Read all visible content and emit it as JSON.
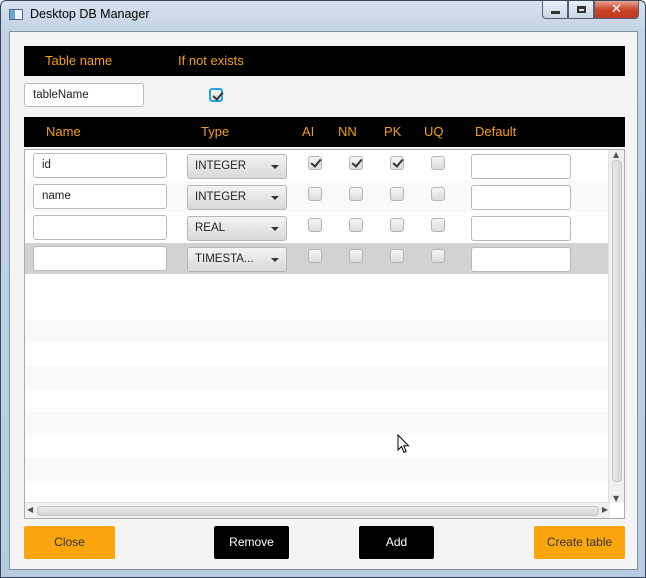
{
  "window": {
    "title": "Desktop DB Manager",
    "controls": {
      "minimize": "min",
      "maximize": "max",
      "close": "X"
    }
  },
  "table_settings": {
    "table_name_label": "Table name",
    "if_not_exists_label": "If not exists",
    "table_name_value": "tableName",
    "if_not_exists_checked": true
  },
  "columns_header": [
    "Name",
    "Type",
    "AI",
    "NN",
    "PK",
    "UQ",
    "Default"
  ],
  "rows": [
    {
      "name": "id",
      "type": "INTEGER",
      "ai": true,
      "nn": true,
      "pk": true,
      "uq": false,
      "default": ""
    },
    {
      "name": "name",
      "type": "INTEGER",
      "ai": false,
      "nn": false,
      "pk": false,
      "uq": false,
      "default": ""
    },
    {
      "name": "",
      "type": "REAL",
      "ai": false,
      "nn": false,
      "pk": false,
      "uq": false,
      "default": ""
    },
    {
      "name": "",
      "type": "TIMESTA...",
      "ai": false,
      "nn": false,
      "pk": false,
      "uq": false,
      "default": "",
      "selected": true
    }
  ],
  "buttons": {
    "close": "Close",
    "remove": "Remove",
    "add": "Add",
    "create_table": "Create table"
  },
  "colors": {
    "header_bg": "#000000",
    "header_text": "#f5a00f",
    "orange_button": "#f9a50b",
    "selected_row": "#d2d2d2"
  }
}
